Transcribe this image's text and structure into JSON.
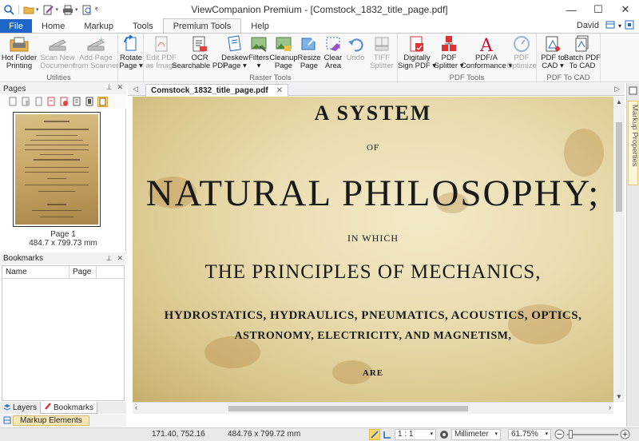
{
  "window": {
    "title": "ViewCompanion Premium - [Comstock_1832_title_page.pdf]"
  },
  "tabs": [
    {
      "label": "File"
    },
    {
      "label": "Home"
    },
    {
      "label": "Markup"
    },
    {
      "label": "Tools"
    },
    {
      "label": "Premium Tools"
    },
    {
      "label": "Help"
    }
  ],
  "user": {
    "name": "David"
  },
  "ribbon": {
    "groups": [
      {
        "label": "Utilities"
      },
      {
        "label": "Raster Tools"
      },
      {
        "label": "PDF Tools"
      },
      {
        "label": "PDF To CAD"
      }
    ],
    "buttons": {
      "hot_folder": "Hot Folder\nPrinting",
      "scan_new": "Scan New\nDocument",
      "add_page": "Add Page\nfrom Scanner",
      "rotate_page": "Rotate\nPage ▾",
      "edit_pdf": "Edit PDF\nas Image",
      "ocr": "OCR\nSearchable PDF",
      "deskew": "Deskew\nPage ▾",
      "filters": "Filters\n▾",
      "cleanup": "Cleanup\nPage",
      "resize": "Resize\nPage",
      "clear_area": "Clear\nArea",
      "undo": "Undo",
      "tiff_splitter": "TIFF\nSplitter",
      "digitally_sign": "Digitally\nSign PDF ▾",
      "pdf_splitter": "PDF\nSplitter ▾",
      "pdfa": "PDF/A\nConformance ▾",
      "pdf_optimize": "PDF\nOptimize",
      "pdf_to_cad": "PDF to\nCAD ▾",
      "batch_pdf": "Batch PDF\nTo CAD"
    }
  },
  "left_panel": {
    "pages_title": "Pages",
    "page_caption": "Page 1",
    "page_size": "484.7 x 799.73 mm",
    "bookmarks_title": "Bookmarks",
    "bookmark_columns": [
      "Name",
      "Page"
    ],
    "bottom_tabs": [
      "Layers",
      "Bookmarks"
    ],
    "markup_elements": "Markup Elements"
  },
  "document": {
    "tab_name": "Comstock_1832_title_page.pdf",
    "lines": [
      "A SYSTEM",
      "OF",
      "NATURAL PHILOSOPHY;",
      "IN WHICH",
      "THE PRINCIPLES OF MECHANICS,",
      "HYDROSTATICS, HYDRAULICS, PNEUMATICS, ACOUSTICS, OPTICS,",
      "ASTRONOMY, ELECTRICITY, AND MAGNETISM,",
      "ARE"
    ]
  },
  "right_panel": {
    "label": "Markup Properties"
  },
  "status": {
    "cursor": "171.40, 752.16",
    "size": "484.76 x 799.72 mm",
    "scale": "1 : 1",
    "unit": "Millimeter",
    "zoom": "61.75%"
  }
}
